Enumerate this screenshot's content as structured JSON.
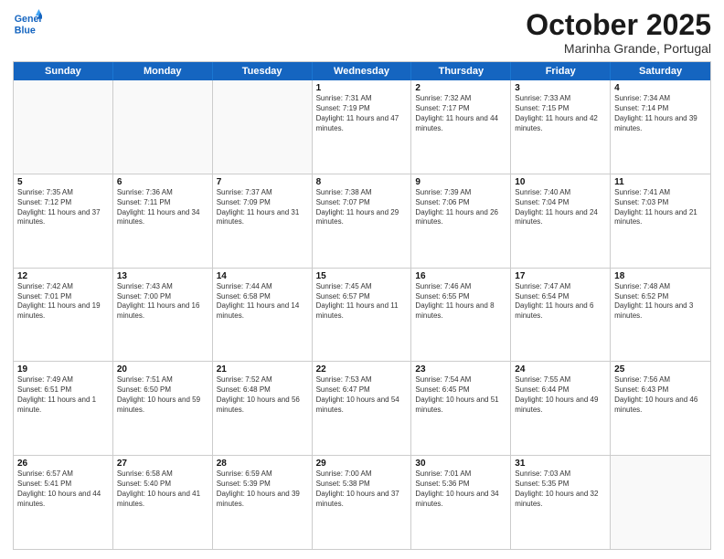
{
  "header": {
    "logo_line1": "General",
    "logo_line2": "Blue",
    "month": "October 2025",
    "location": "Marinha Grande, Portugal"
  },
  "weekdays": [
    "Sunday",
    "Monday",
    "Tuesday",
    "Wednesday",
    "Thursday",
    "Friday",
    "Saturday"
  ],
  "rows": [
    [
      {
        "day": "",
        "sunrise": "",
        "sunset": "",
        "daylight": "",
        "empty": true
      },
      {
        "day": "",
        "sunrise": "",
        "sunset": "",
        "daylight": "",
        "empty": true
      },
      {
        "day": "",
        "sunrise": "",
        "sunset": "",
        "daylight": "",
        "empty": true
      },
      {
        "day": "1",
        "sunrise": "Sunrise: 7:31 AM",
        "sunset": "Sunset: 7:19 PM",
        "daylight": "Daylight: 11 hours and 47 minutes.",
        "empty": false
      },
      {
        "day": "2",
        "sunrise": "Sunrise: 7:32 AM",
        "sunset": "Sunset: 7:17 PM",
        "daylight": "Daylight: 11 hours and 44 minutes.",
        "empty": false
      },
      {
        "day": "3",
        "sunrise": "Sunrise: 7:33 AM",
        "sunset": "Sunset: 7:15 PM",
        "daylight": "Daylight: 11 hours and 42 minutes.",
        "empty": false
      },
      {
        "day": "4",
        "sunrise": "Sunrise: 7:34 AM",
        "sunset": "Sunset: 7:14 PM",
        "daylight": "Daylight: 11 hours and 39 minutes.",
        "empty": false
      }
    ],
    [
      {
        "day": "5",
        "sunrise": "Sunrise: 7:35 AM",
        "sunset": "Sunset: 7:12 PM",
        "daylight": "Daylight: 11 hours and 37 minutes.",
        "empty": false
      },
      {
        "day": "6",
        "sunrise": "Sunrise: 7:36 AM",
        "sunset": "Sunset: 7:11 PM",
        "daylight": "Daylight: 11 hours and 34 minutes.",
        "empty": false
      },
      {
        "day": "7",
        "sunrise": "Sunrise: 7:37 AM",
        "sunset": "Sunset: 7:09 PM",
        "daylight": "Daylight: 11 hours and 31 minutes.",
        "empty": false
      },
      {
        "day": "8",
        "sunrise": "Sunrise: 7:38 AM",
        "sunset": "Sunset: 7:07 PM",
        "daylight": "Daylight: 11 hours and 29 minutes.",
        "empty": false
      },
      {
        "day": "9",
        "sunrise": "Sunrise: 7:39 AM",
        "sunset": "Sunset: 7:06 PM",
        "daylight": "Daylight: 11 hours and 26 minutes.",
        "empty": false
      },
      {
        "day": "10",
        "sunrise": "Sunrise: 7:40 AM",
        "sunset": "Sunset: 7:04 PM",
        "daylight": "Daylight: 11 hours and 24 minutes.",
        "empty": false
      },
      {
        "day": "11",
        "sunrise": "Sunrise: 7:41 AM",
        "sunset": "Sunset: 7:03 PM",
        "daylight": "Daylight: 11 hours and 21 minutes.",
        "empty": false
      }
    ],
    [
      {
        "day": "12",
        "sunrise": "Sunrise: 7:42 AM",
        "sunset": "Sunset: 7:01 PM",
        "daylight": "Daylight: 11 hours and 19 minutes.",
        "empty": false
      },
      {
        "day": "13",
        "sunrise": "Sunrise: 7:43 AM",
        "sunset": "Sunset: 7:00 PM",
        "daylight": "Daylight: 11 hours and 16 minutes.",
        "empty": false
      },
      {
        "day": "14",
        "sunrise": "Sunrise: 7:44 AM",
        "sunset": "Sunset: 6:58 PM",
        "daylight": "Daylight: 11 hours and 14 minutes.",
        "empty": false
      },
      {
        "day": "15",
        "sunrise": "Sunrise: 7:45 AM",
        "sunset": "Sunset: 6:57 PM",
        "daylight": "Daylight: 11 hours and 11 minutes.",
        "empty": false
      },
      {
        "day": "16",
        "sunrise": "Sunrise: 7:46 AM",
        "sunset": "Sunset: 6:55 PM",
        "daylight": "Daylight: 11 hours and 8 minutes.",
        "empty": false
      },
      {
        "day": "17",
        "sunrise": "Sunrise: 7:47 AM",
        "sunset": "Sunset: 6:54 PM",
        "daylight": "Daylight: 11 hours and 6 minutes.",
        "empty": false
      },
      {
        "day": "18",
        "sunrise": "Sunrise: 7:48 AM",
        "sunset": "Sunset: 6:52 PM",
        "daylight": "Daylight: 11 hours and 3 minutes.",
        "empty": false
      }
    ],
    [
      {
        "day": "19",
        "sunrise": "Sunrise: 7:49 AM",
        "sunset": "Sunset: 6:51 PM",
        "daylight": "Daylight: 11 hours and 1 minute.",
        "empty": false
      },
      {
        "day": "20",
        "sunrise": "Sunrise: 7:51 AM",
        "sunset": "Sunset: 6:50 PM",
        "daylight": "Daylight: 10 hours and 59 minutes.",
        "empty": false
      },
      {
        "day": "21",
        "sunrise": "Sunrise: 7:52 AM",
        "sunset": "Sunset: 6:48 PM",
        "daylight": "Daylight: 10 hours and 56 minutes.",
        "empty": false
      },
      {
        "day": "22",
        "sunrise": "Sunrise: 7:53 AM",
        "sunset": "Sunset: 6:47 PM",
        "daylight": "Daylight: 10 hours and 54 minutes.",
        "empty": false
      },
      {
        "day": "23",
        "sunrise": "Sunrise: 7:54 AM",
        "sunset": "Sunset: 6:45 PM",
        "daylight": "Daylight: 10 hours and 51 minutes.",
        "empty": false
      },
      {
        "day": "24",
        "sunrise": "Sunrise: 7:55 AM",
        "sunset": "Sunset: 6:44 PM",
        "daylight": "Daylight: 10 hours and 49 minutes.",
        "empty": false
      },
      {
        "day": "25",
        "sunrise": "Sunrise: 7:56 AM",
        "sunset": "Sunset: 6:43 PM",
        "daylight": "Daylight: 10 hours and 46 minutes.",
        "empty": false
      }
    ],
    [
      {
        "day": "26",
        "sunrise": "Sunrise: 6:57 AM",
        "sunset": "Sunset: 5:41 PM",
        "daylight": "Daylight: 10 hours and 44 minutes.",
        "empty": false
      },
      {
        "day": "27",
        "sunrise": "Sunrise: 6:58 AM",
        "sunset": "Sunset: 5:40 PM",
        "daylight": "Daylight: 10 hours and 41 minutes.",
        "empty": false
      },
      {
        "day": "28",
        "sunrise": "Sunrise: 6:59 AM",
        "sunset": "Sunset: 5:39 PM",
        "daylight": "Daylight: 10 hours and 39 minutes.",
        "empty": false
      },
      {
        "day": "29",
        "sunrise": "Sunrise: 7:00 AM",
        "sunset": "Sunset: 5:38 PM",
        "daylight": "Daylight: 10 hours and 37 minutes.",
        "empty": false
      },
      {
        "day": "30",
        "sunrise": "Sunrise: 7:01 AM",
        "sunset": "Sunset: 5:36 PM",
        "daylight": "Daylight: 10 hours and 34 minutes.",
        "empty": false
      },
      {
        "day": "31",
        "sunrise": "Sunrise: 7:03 AM",
        "sunset": "Sunset: 5:35 PM",
        "daylight": "Daylight: 10 hours and 32 minutes.",
        "empty": false
      },
      {
        "day": "",
        "sunrise": "",
        "sunset": "",
        "daylight": "",
        "empty": true
      }
    ]
  ]
}
